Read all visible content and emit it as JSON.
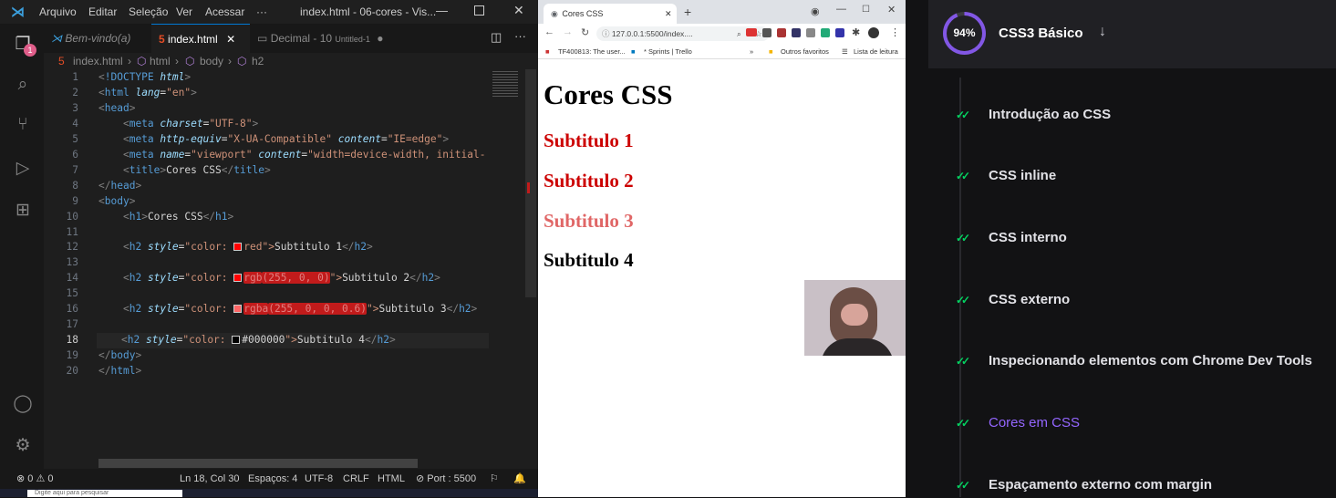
{
  "vscode": {
    "menu": [
      "Arquivo",
      "Editar",
      "Seleção",
      "Ver",
      "Acessar",
      "···"
    ],
    "window_title": "index.html - 06-cores - Vis...",
    "explorer_badge": "1",
    "tabs": [
      {
        "label": "Bem-vindo(a)",
        "icon": "vscode-icon"
      },
      {
        "label": "index.html",
        "icon": "html5-icon"
      },
      {
        "label": "Decimal - 10",
        "sublabel": "Untitled-1",
        "icon": "file-icon"
      }
    ],
    "breadcrumb": [
      "index.html",
      "html",
      "body",
      "h2"
    ],
    "lines": [
      "1",
      "2",
      "3",
      "4",
      "5",
      "6",
      "7",
      "8",
      "9",
      "10",
      "11",
      "12",
      "13",
      "14",
      "15",
      "16",
      "17",
      "18",
      "19",
      "20"
    ],
    "code": {
      "l1_doctype": "<!DOCTYPE",
      "l1_html": "html",
      "l1_close": ">",
      "lang_val": "\"en\"",
      "charset_val": "\"UTF-8\"",
      "http_equiv_val": "\"X-UA-Compatible\"",
      "content_ie": "\"IE=edge\"",
      "name_val": "\"viewport\"",
      "content_vp": "\"width=device-width, initial-",
      "title_text": "Cores CSS",
      "h1_text": "Cores CSS",
      "style_open": "\"color: ",
      "c1": "red",
      "c2_fn": "rgb",
      "c2_args": "(255, 0, 0)",
      "c3_fn": "rgba",
      "c3_args": "(255, 0, 0, 0.6)",
      "c4": "#000000",
      "quote_close": "\">",
      "s1": "Subtitulo 1",
      "s2": "Subtitulo 2",
      "s3": "Subtitulo 3",
      "s4": "Subtitulo 4"
    },
    "status": {
      "problems": "⊗ 0 ⚠ 0",
      "position": "Ln 18, Col 30",
      "spaces": "Espaços: 4",
      "encoding": "UTF-8",
      "eol": "CRLF",
      "language": "HTML",
      "port": "⊘ Port : 5500"
    }
  },
  "taskbar": {
    "search_placeholder": "Digite aqui para pesquisar"
  },
  "chrome": {
    "tab_title": "Cores CSS",
    "url": "127.0.0.1:5500/index....",
    "bookmarks": [
      "TF400813: The user...",
      "* Sprints | Trello",
      "»",
      "Outros favoritos",
      "Lista de leitura"
    ],
    "page": {
      "h1": "Cores CSS",
      "h2": [
        {
          "text": "Subtitulo 1",
          "color": "#cc0000"
        },
        {
          "text": "Subtitulo 2",
          "color": "#cc0000"
        },
        {
          "text": "Subtitulo 3",
          "color": "#e06666"
        },
        {
          "text": "Subtitulo 4",
          "color": "#000000"
        }
      ]
    }
  },
  "course": {
    "progress": "94%",
    "progress_value": 0.94,
    "title": "CSS3 Básico",
    "accent": "#8257e5",
    "check_color": "#04d361",
    "lessons": [
      {
        "label": "Introdução ao CSS",
        "active": false
      },
      {
        "label": "CSS inline",
        "active": false
      },
      {
        "label": "CSS interno",
        "active": false
      },
      {
        "label": "CSS externo",
        "active": false
      },
      {
        "label": "Inspecionando elementos com Chrome Dev Tools",
        "active": false
      },
      {
        "label": "Cores em CSS",
        "active": true
      },
      {
        "label": "Espaçamento externo com margin",
        "active": false
      }
    ]
  }
}
